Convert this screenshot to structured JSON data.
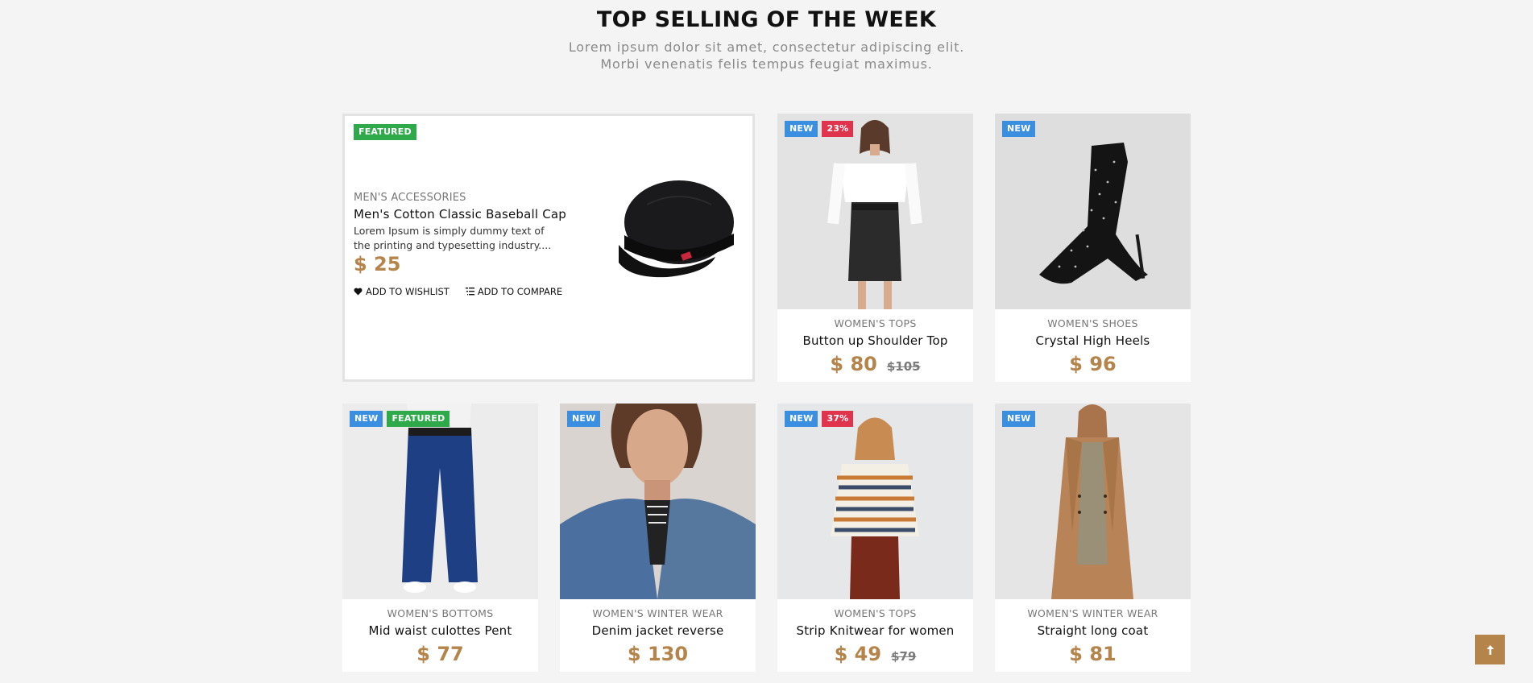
{
  "section": {
    "title": "TOP SELLING OF THE WEEK",
    "subtitle_line1": "Lorem ipsum dolor sit amet, consectetur adipiscing elit.",
    "subtitle_line2": "Morbi venenatis felis tempus feugiat maximus."
  },
  "featured": {
    "badge": "FEATURED",
    "category": "MEN'S ACCESSORIES",
    "name": "Men's Cotton Classic Baseball Cap",
    "description_line1": "Lorem Ipsum is simply dummy text of",
    "description_line2": "the printing and typesetting industry....",
    "price": "$ 25",
    "wishlist_label": "ADD TO WISHLIST",
    "compare_label": "ADD TO COMPARE"
  },
  "products": [
    {
      "badges": [
        "NEW",
        "23%"
      ],
      "category": "WOMEN'S TOPS",
      "name": "Button up Shoulder Top",
      "price": "$ 80",
      "old_price": "$105"
    },
    {
      "badges": [
        "NEW"
      ],
      "category": "WOMEN'S SHOES",
      "name": "Crystal High Heels",
      "price": "$ 96",
      "old_price": ""
    },
    {
      "badges": [
        "NEW",
        "FEATURED"
      ],
      "category": "WOMEN'S BOTTOMS",
      "name": "Mid waist culottes Pent",
      "price": "$ 77",
      "old_price": ""
    },
    {
      "badges": [
        "NEW"
      ],
      "category": "WOMEN'S WINTER WEAR",
      "name": "Denim jacket reverse",
      "price": "$ 130",
      "old_price": ""
    },
    {
      "badges": [
        "NEW",
        "37%"
      ],
      "category": "WOMEN'S TOPS",
      "name": "Strip Knitwear for women",
      "price": "$ 49",
      "old_price": "$79"
    },
    {
      "badges": [
        "NEW"
      ],
      "category": "WOMEN'S WINTER WEAR",
      "name": "Straight long coat",
      "price": "$ 81",
      "old_price": ""
    }
  ],
  "colors": {
    "accent": "#b5844a",
    "badge_new": "#3b8fe0",
    "badge_featured": "#2eaa4a",
    "badge_sale": "#e0334c",
    "background": "#f4f4f4"
  },
  "icons": {
    "wishlist": "heart-icon",
    "compare": "list-icon",
    "scroll_top": "arrow-up-icon"
  }
}
